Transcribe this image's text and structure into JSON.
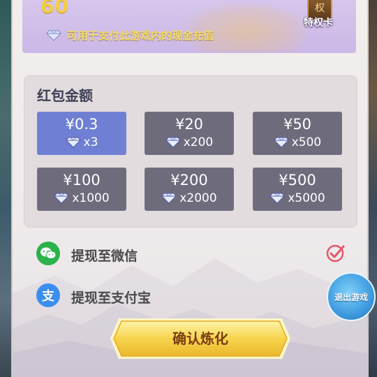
{
  "banner": {
    "value": "60",
    "info_text": "可用于支付此游戏内的现金充值",
    "privilege_badge": "权",
    "privilege_label": "特权卡"
  },
  "amount": {
    "title": "红包金额",
    "options": [
      {
        "price": "¥0.3",
        "gems": "x3",
        "selected": true
      },
      {
        "price": "¥20",
        "gems": "x200",
        "selected": false
      },
      {
        "price": "¥50",
        "gems": "x500",
        "selected": false
      },
      {
        "price": "¥100",
        "gems": "x1000",
        "selected": false
      },
      {
        "price": "¥200",
        "gems": "x2000",
        "selected": false
      },
      {
        "price": "¥500",
        "gems": "x5000",
        "selected": false
      }
    ]
  },
  "withdraw": {
    "wechat_label": "提现至微信",
    "wechat_icon": "wechat-icon",
    "alipay_label": "提现至支付宝",
    "alipay_icon_glyph": "支",
    "selected_method": "wechat"
  },
  "exit_label": "退出游戏",
  "confirm_label": "确认炼化",
  "colors": {
    "selected_option": "#6f7fd4",
    "option": "#6e6b7c",
    "wechat_green": "#2bb24a",
    "alipay_blue": "#3b8ef0",
    "check_red": "#e8546a",
    "confirm_gold": "#f4c843"
  }
}
